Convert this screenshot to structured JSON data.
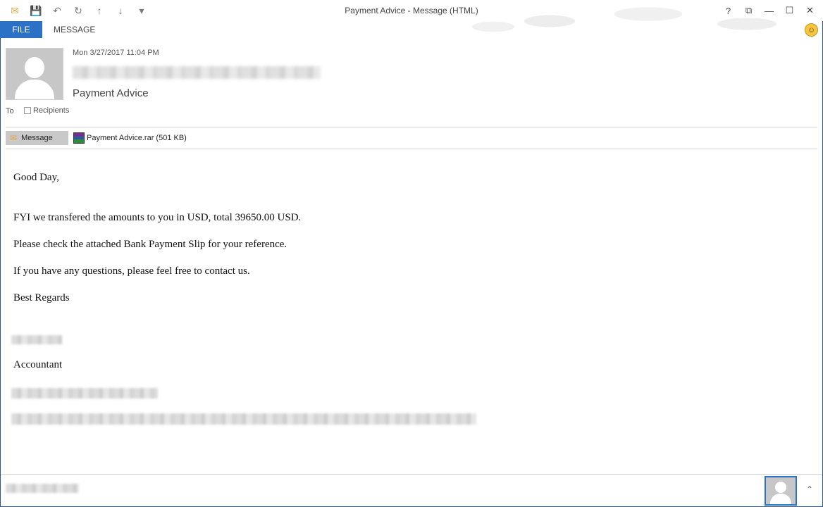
{
  "window": {
    "title": "Payment Advice - Message (HTML)",
    "qat_icons": [
      "envelope-icon",
      "save-icon",
      "undo-icon",
      "redo-icon",
      "up-arrow-icon",
      "down-arrow-icon",
      "customize-icon"
    ],
    "controls": {
      "help": "?",
      "restore_ribbon": "⧉",
      "minimize": "—",
      "maximize": "☐",
      "close": "✕"
    }
  },
  "ribbon": {
    "file_tab": "FILE",
    "message_tab": "MESSAGE"
  },
  "header": {
    "date": "Mon 3/27/2017 11:04 PM",
    "subject": "Payment Advice",
    "to_label": "To",
    "recipients_label": "Recipients"
  },
  "attachments": {
    "message_label": "Message",
    "file_label": "Payment Advice.rar (501 KB)"
  },
  "body": {
    "greeting": "Good Day,",
    "line1": "FYI we transfered the amounts to you in USD, total 39650.00 USD.",
    "line2": "Please check the attached Bank Payment Slip for your reference.",
    "line3": "If you have any questions, please feel free to contact us.",
    "closing": "Best Regards",
    "title": "Accountant"
  },
  "colors": {
    "accent": "#2b72c7",
    "border": "#2b579a"
  }
}
